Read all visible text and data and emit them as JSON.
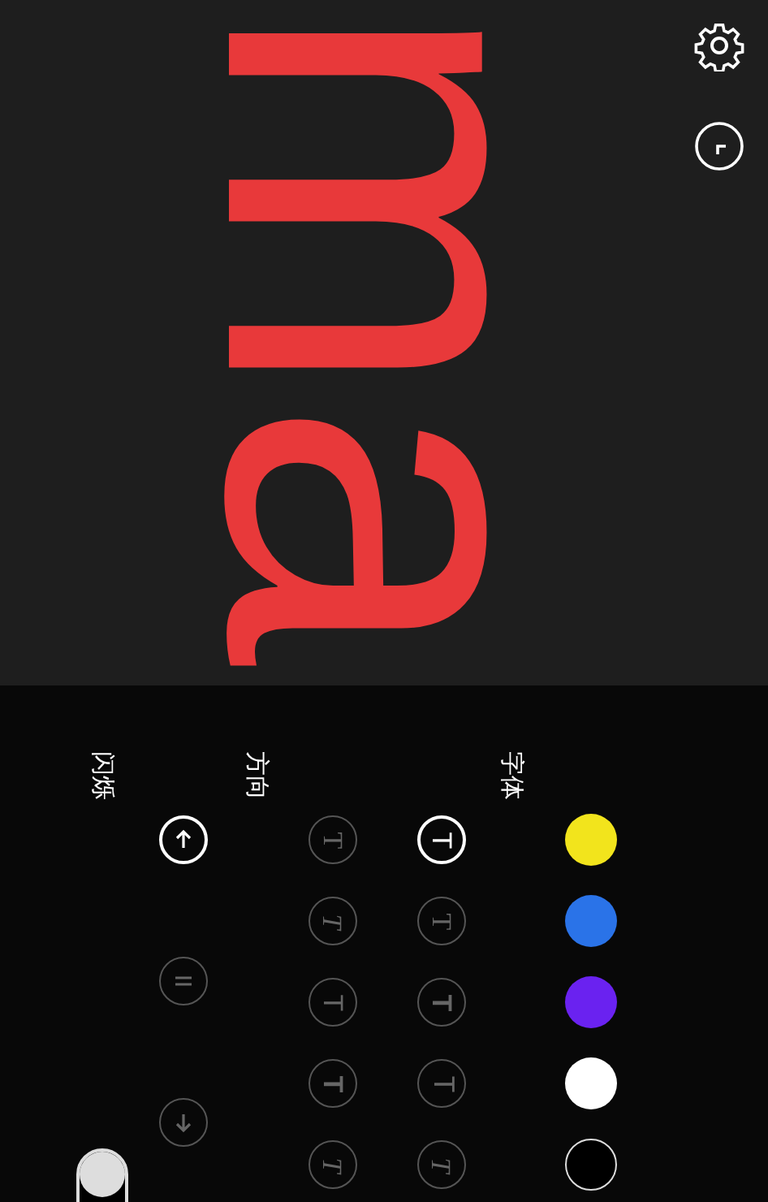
{
  "display": {
    "text": "ma",
    "color": "#e8393a"
  },
  "panel": {
    "colors": [
      {
        "color": "#f2e41c"
      },
      {
        "color": "#2a73e8"
      },
      {
        "color": "#6a22f0"
      },
      {
        "color": "#ffffff"
      },
      {
        "color": "#000000"
      }
    ],
    "font_label": "字体",
    "fonts": [
      {
        "glyph": "T",
        "kind": "sans",
        "selected": true
      },
      {
        "glyph": "T",
        "kind": "serif",
        "selected": false
      },
      {
        "glyph": "T",
        "kind": "bold",
        "selected": false
      },
      {
        "glyph": "T",
        "kind": "light",
        "selected": false
      },
      {
        "glyph": "T",
        "kind": "italic",
        "selected": false
      },
      {
        "glyph": "T",
        "kind": "serif",
        "selected": false
      },
      {
        "glyph": "T",
        "kind": "italic",
        "selected": false
      },
      {
        "glyph": "T",
        "kind": "sans",
        "selected": false
      },
      {
        "glyph": "T",
        "kind": "bold",
        "selected": false
      },
      {
        "glyph": "T",
        "kind": "italic",
        "selected": false
      }
    ],
    "direction_label": "方向",
    "directions": [
      {
        "kind": "up",
        "selected": true
      },
      {
        "kind": "pause",
        "selected": false
      },
      {
        "kind": "down",
        "selected": false
      }
    ],
    "blink_label": "闪烁",
    "blink": {
      "on": false
    }
  }
}
